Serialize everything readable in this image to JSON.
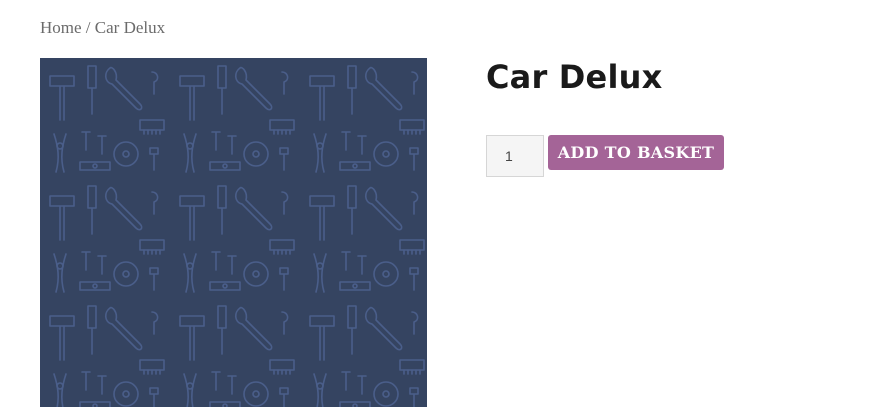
{
  "breadcrumb": {
    "home": "Home",
    "separator": " / ",
    "current": "Car Delux"
  },
  "product": {
    "title": "Car Delux",
    "image_icon": "tools-pattern-image",
    "quantity_value": "1",
    "add_to_basket_label": "ADD TO BASKET"
  },
  "colors": {
    "image_background": "#354461",
    "image_lines": "#4b5f8c",
    "button": "#a46497",
    "button_text": "#ffffff",
    "breadcrumb_text": "#6b6b6b",
    "title_text": "#1a1a1a"
  }
}
